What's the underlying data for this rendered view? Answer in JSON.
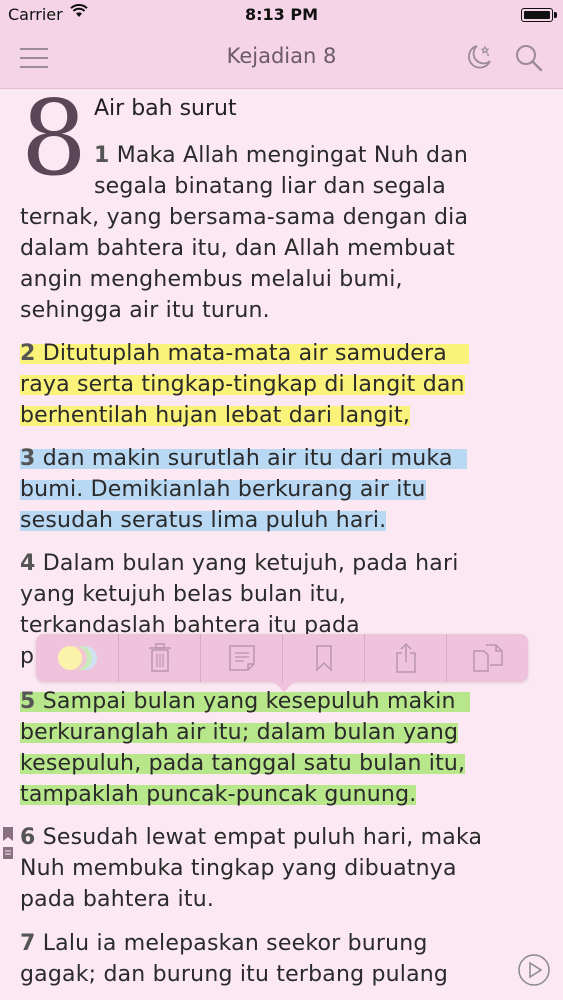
{
  "status": {
    "carrier": "Carrier",
    "time": "8:13 PM"
  },
  "nav": {
    "title": "Kejadian 8"
  },
  "chapter": {
    "number": "8",
    "section_title": "Air bah surut"
  },
  "verses": [
    {
      "num": "1",
      "lines": [
        "Maka Allah mengingat Nuh dan",
        "segala binatang liar dan segala",
        "ternak, yang bersama-sama dengan dia",
        "dalam bahtera itu, dan Allah membuat",
        "angin menghembus melalui bumi,",
        "sehingga air itu turun."
      ]
    },
    {
      "num": "2",
      "highlight": "yellow",
      "lines": [
        "Ditutuplah mata-mata air samudera",
        "raya serta tingkap-tingkap di langit dan",
        "berhentilah hujan lebat dari langit,"
      ]
    },
    {
      "num": "3",
      "highlight": "blue",
      "lines": [
        "dan makin surutlah air itu dari muka",
        "bumi. Demikianlah berkurang air itu",
        "sesudah seratus lima puluh hari."
      ]
    },
    {
      "num": "4",
      "lines": [
        "Dalam bulan yang ketujuh, pada hari",
        "yang ketujuh belas bulan itu,",
        "terkandaslah bahtera itu pada",
        "p"
      ]
    },
    {
      "num": "5",
      "highlight": "green",
      "lines": [
        "Sampai bulan yang kesepuluh makin",
        "berkuranglah air itu; dalam bulan yang",
        "kesepuluh, pada tanggal satu bulan itu,",
        "tampaklah puncak-puncak gunung."
      ]
    },
    {
      "num": "6",
      "lines": [
        "Sesudah lewat empat puluh hari, maka",
        "Nuh membuka tingkap yang dibuatnya",
        "pada bahtera itu."
      ]
    },
    {
      "num": "7",
      "lines": [
        "Lalu ia melepaskan seekor burung",
        "gagak; dan burung itu terbang pulang"
      ]
    }
  ],
  "colors": {
    "background": "#fbe8f2",
    "bar": "#f4d4e6",
    "yellow": "#fbf27a",
    "blue": "#b8d8f4",
    "green": "#b8e68a"
  },
  "toolbar_icons": [
    "color-picker-icon",
    "trash-icon",
    "note-icon",
    "bookmark-icon",
    "share-icon",
    "copy-icon"
  ]
}
